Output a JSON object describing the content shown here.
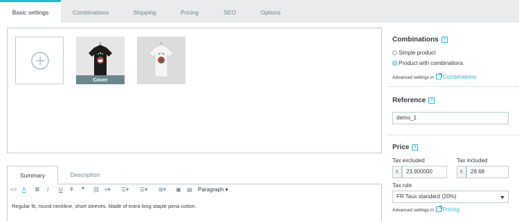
{
  "tabs": [
    {
      "label": "Basic settings",
      "active": true
    },
    {
      "label": "Combinations",
      "active": false
    },
    {
      "label": "Shipping",
      "active": false
    },
    {
      "label": "Pricing",
      "active": false
    },
    {
      "label": "SEO",
      "active": false
    },
    {
      "label": "Options",
      "active": false
    }
  ],
  "images": {
    "cover_label": "Cover",
    "thumbnails": [
      {
        "shirt_color": "#1d1d1d",
        "cover": true
      },
      {
        "shirt_color": "#f2f2f2",
        "cover": false
      }
    ]
  },
  "description_tabs": [
    {
      "label": "Summary",
      "active": true
    },
    {
      "label": "Description",
      "active": false
    }
  ],
  "editor": {
    "paragraph_label": "Paragraph",
    "text": "Regular fit, round neckline, short sleeves. Made of extra long staple pima cotton."
  },
  "combinations": {
    "title": "Combinations",
    "help": "?",
    "options": [
      {
        "label": "Simple product",
        "checked": false
      },
      {
        "label": "Product with combinations",
        "checked": true
      }
    ],
    "advanced_label": "Advanced settings in",
    "advanced_link": "Combinations"
  },
  "reference": {
    "title": "Reference",
    "help": "?",
    "value": "demo_1"
  },
  "price": {
    "title": "Price",
    "help": "?",
    "tax_excluded_label": "Tax excluded",
    "tax_included_label": "Tax included",
    "currency": "€",
    "tax_excluded_value": "23.900000",
    "tax_included_value": "28.68",
    "tax_rule_label": "Tax rule",
    "tax_rule_value": "FR Taux standard (20%)",
    "advanced_label": "Advanced settings in",
    "advanced_link": "Pricing"
  },
  "colors": {
    "accent": "#25b9d7",
    "border": "#bbcdd2",
    "muted": "#6c868e",
    "cover_bar": "#6c868e"
  }
}
